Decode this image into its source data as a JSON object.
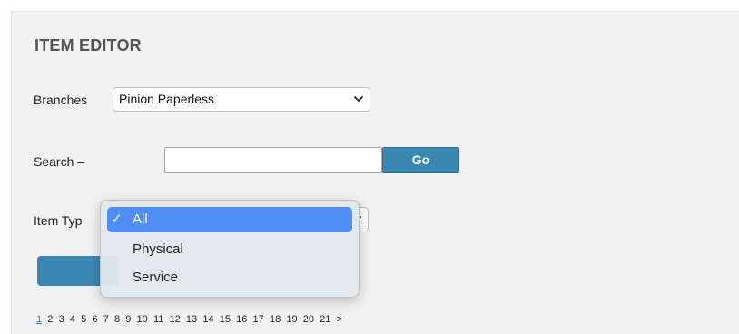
{
  "editor": {
    "title": "ITEM EDITOR"
  },
  "branches": {
    "label": "Branches",
    "selected": "Pinion Paperless"
  },
  "search": {
    "label": "Search –",
    "value": "",
    "go_label": "Go"
  },
  "item_type": {
    "label": "Item Typ",
    "options": [
      {
        "label": "All",
        "check": "✓",
        "selected": true
      },
      {
        "label": "Physical",
        "check": "",
        "selected": false
      },
      {
        "label": "Service",
        "check": "",
        "selected": false
      }
    ]
  },
  "pagination": {
    "pages": [
      "1",
      "2",
      "3",
      "4",
      "5",
      "6",
      "7",
      "8",
      "9",
      "10",
      "11",
      "12",
      "13",
      "14",
      "15",
      "16",
      "17",
      "18",
      "19",
      "20",
      "21"
    ],
    "current": "1",
    "next": ">"
  },
  "colors": {
    "accent": "#3b87b4",
    "selection": "#4f8ef7",
    "panel": "#f2f2f2"
  }
}
